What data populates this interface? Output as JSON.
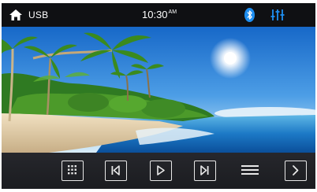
{
  "status_bar": {
    "source_label": "USB",
    "time": "10:30",
    "time_suffix": "AM",
    "icons": [
      "home-icon",
      "bluetooth-icon",
      "equalizer-icon"
    ],
    "accent_color": "#1e8ef0"
  },
  "media": {
    "image": "tropical-beach-photo"
  },
  "controls": {
    "icons": [
      "grid-menu-icon",
      "previous-track-icon",
      "play-icon",
      "next-track-icon",
      "list-icon",
      "forward-chevron-icon"
    ],
    "icon_color": "#e8e8e8",
    "bar_color": "#1f2024"
  }
}
